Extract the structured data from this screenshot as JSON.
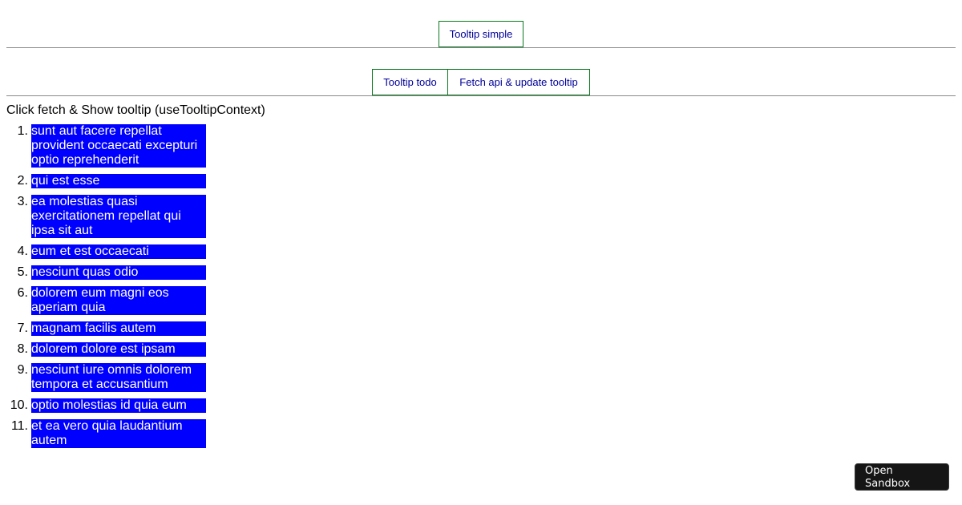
{
  "buttons": {
    "tooltip_simple": "Tooltip simple",
    "tooltip_todo": "Tooltip todo",
    "fetch_api": "Fetch api & update tooltip"
  },
  "heading": "Click fetch & Show tooltip (useTooltipContext)",
  "posts": [
    "sunt aut facere repellat provident occaecati excepturi optio reprehenderit",
    "qui est esse",
    "ea molestias quasi exercitationem repellat qui ipsa sit aut",
    "eum et est occaecati",
    "nesciunt quas odio",
    "dolorem eum magni eos aperiam quia",
    "magnam facilis autem",
    "dolorem dolore est ipsam",
    "nesciunt iure omnis dolorem tempora et accusantium",
    "optio molestias id quia eum",
    "et ea vero quia laudantium autem"
  ],
  "sandbox_button": "Open Sandbox",
  "colors": {
    "button_border": "#0a7a1e",
    "button_text": "#000099",
    "post_bg": "#0000ff",
    "post_text": "#ffffff",
    "sandbox_bg": "#151515"
  }
}
